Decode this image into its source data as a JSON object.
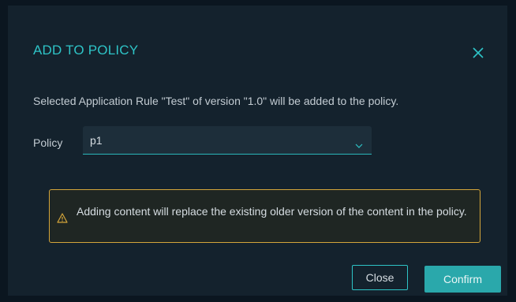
{
  "dialog": {
    "title": "ADD TO POLICY",
    "close_icon": "close-icon",
    "message": "Selected Application Rule \"Test\" of version \"1.0\" will be added to the policy."
  },
  "policy": {
    "label": "Policy",
    "selected": "p1",
    "chevron_icon": "chevron-down-icon"
  },
  "warning": {
    "icon": "warning-icon",
    "text": "Adding content will replace the existing older version of the content in the policy."
  },
  "buttons": {
    "close_label": "Close",
    "confirm_label": "Confirm"
  },
  "colors": {
    "accent": "#2ec4c7",
    "warning_border": "#d4a53a",
    "confirm_bg": "#2aa8ab",
    "dialog_bg": "#14222d"
  }
}
